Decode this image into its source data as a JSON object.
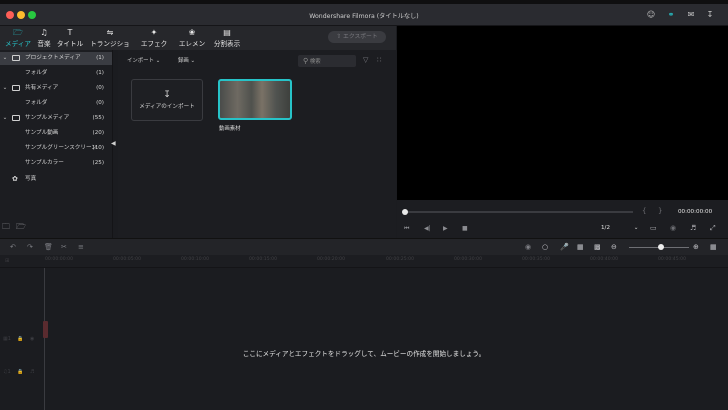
{
  "window": {
    "title": "Wondershare Filmora (タイトルなし)"
  },
  "toolbar": {
    "tabs": [
      {
        "label": "メディア",
        "icon": "folder-icon",
        "active": true
      },
      {
        "label": "音楽",
        "icon": "music-icon",
        "active": false
      },
      {
        "label": "タイトル",
        "icon": "title-icon",
        "active": false
      },
      {
        "label": "トランジション",
        "icon": "transition-icon",
        "active": false
      },
      {
        "label": "エフェクト",
        "icon": "effect-icon",
        "active": false
      },
      {
        "label": "エレメント",
        "icon": "element-icon",
        "active": false
      },
      {
        "label": "分割表示",
        "icon": "split-screen-icon",
        "active": false
      }
    ],
    "export_label": "エクスポート"
  },
  "sidebar": {
    "items": [
      {
        "label": "プロジェクトメディア",
        "count": "(1)",
        "type": "group"
      },
      {
        "label": "フォルダ",
        "count": "(1)",
        "type": "child"
      },
      {
        "label": "共有メディア",
        "count": "(0)",
        "type": "group"
      },
      {
        "label": "フォルダ",
        "count": "(0)",
        "type": "child"
      },
      {
        "label": "サンプルメディア",
        "count": "(55)",
        "type": "group"
      },
      {
        "label": "サンプル動画",
        "count": "(20)",
        "type": "child"
      },
      {
        "label": "サンプルグリーンスクリーン",
        "count": "(10)",
        "type": "child"
      },
      {
        "label": "サンプルカラー",
        "count": "(25)",
        "type": "child"
      },
      {
        "label": "写真",
        "count": "",
        "type": "special"
      }
    ]
  },
  "media": {
    "import_dropdown": "インポート",
    "record_dropdown": "録画",
    "search_placeholder": "検索",
    "import_tile_label": "メディアのインポート",
    "clip_label": "動画素材"
  },
  "preview": {
    "timecode": "00:00:00:00",
    "quality": "1/2"
  },
  "timeline": {
    "ruler_ticks": [
      "00:00:00:00",
      "00:00:05:00",
      "00:00:10:00",
      "00:00:15:00",
      "00:00:20:00",
      "00:00:25:00",
      "00:00:30:00",
      "00:00:35:00",
      "00:00:40:00",
      "00:00:45:00"
    ],
    "empty_hint": "ここにメディアとエフェクトをドラッグして、ムービーの作成を開始しましょう。"
  },
  "colors": {
    "accent": "#27c3c8"
  }
}
